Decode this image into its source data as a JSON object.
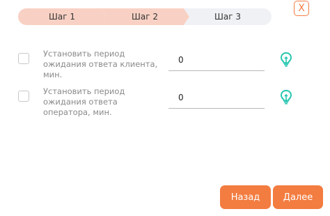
{
  "stepper": {
    "steps": [
      {
        "label": "Шаг 1",
        "state": "completed"
      },
      {
        "label": "Шаг 2",
        "state": "active"
      },
      {
        "label": "Шаг 3",
        "state": "pending"
      }
    ]
  },
  "close_button": {
    "label": "X"
  },
  "settings": [
    {
      "label": "Установить период ожидания ответа клиента, мин.",
      "value": "0",
      "checked": false,
      "icon": "lightbulb-icon"
    },
    {
      "label": "Установить период ожидания ответа оператора, мин.",
      "value": "0",
      "checked": false,
      "icon": "lightbulb-icon"
    }
  ],
  "buttons": {
    "back_label": "Назад",
    "next_label": "Далее"
  },
  "colors": {
    "accent": "#f37c40",
    "step_done": "#f8d1c4",
    "step_pending": "#f0f1f5",
    "hint_icon": "#26c6b0"
  }
}
